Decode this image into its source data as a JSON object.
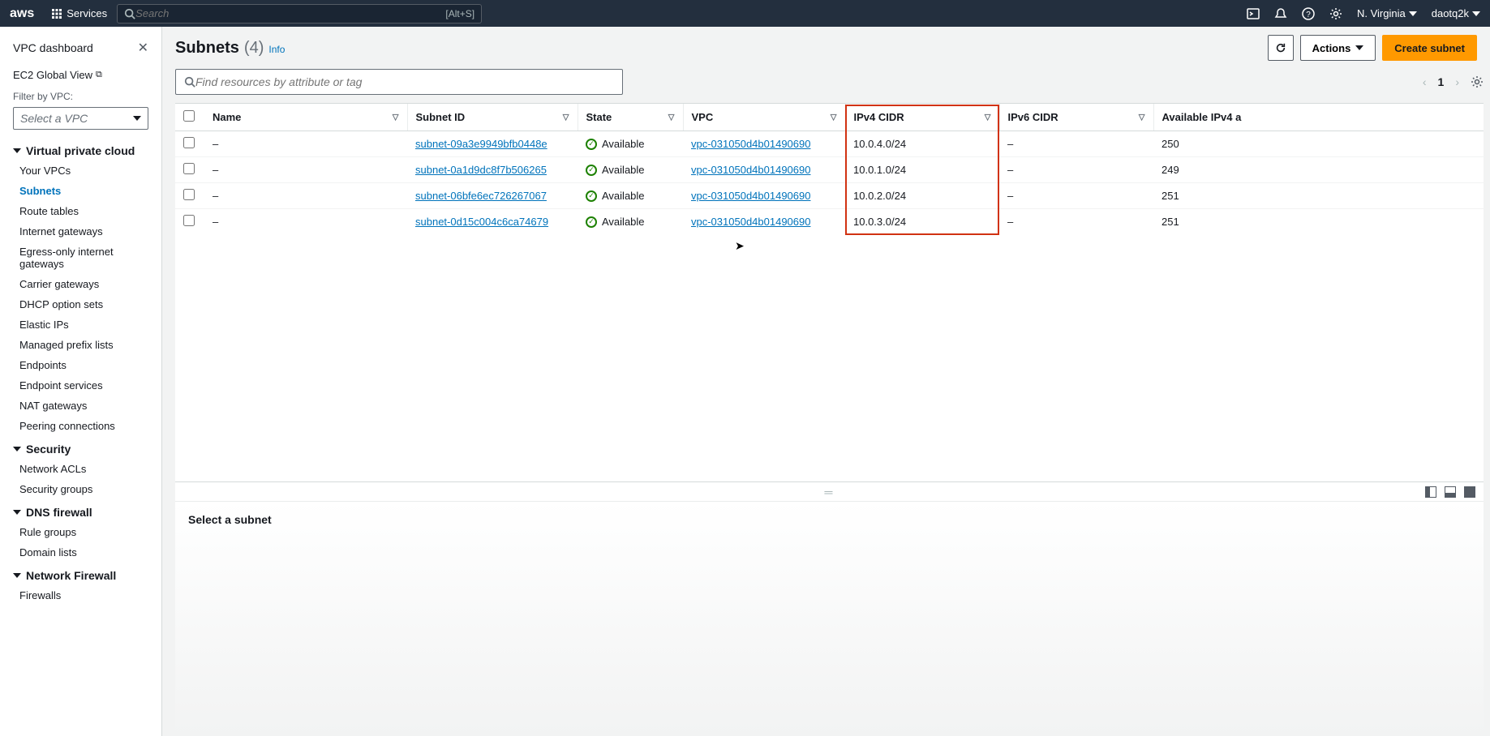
{
  "topnav": {
    "logo": "aws",
    "services": "Services",
    "search_placeholder": "Search",
    "search_shortcut": "[Alt+S]",
    "region": "N. Virginia",
    "user": "daotq2k"
  },
  "sidebar": {
    "dashboard": "VPC dashboard",
    "global_view": "EC2 Global View",
    "filter_label": "Filter by VPC:",
    "filter_placeholder": "Select a VPC",
    "sections": [
      {
        "title": "Virtual private cloud",
        "items": [
          "Your VPCs",
          "Subnets",
          "Route tables",
          "Internet gateways",
          "Egress-only internet gateways",
          "Carrier gateways",
          "DHCP option sets",
          "Elastic IPs",
          "Managed prefix lists",
          "Endpoints",
          "Endpoint services",
          "NAT gateways",
          "Peering connections"
        ],
        "active": "Subnets"
      },
      {
        "title": "Security",
        "items": [
          "Network ACLs",
          "Security groups"
        ]
      },
      {
        "title": "DNS firewall",
        "items": [
          "Rule groups",
          "Domain lists"
        ]
      },
      {
        "title": "Network Firewall",
        "items": [
          "Firewalls"
        ]
      }
    ]
  },
  "page": {
    "title": "Subnets",
    "count": "(4)",
    "info": "Info",
    "actions_label": "Actions",
    "create_label": "Create subnet",
    "filter_placeholder": "Find resources by attribute or tag",
    "page_num": "1",
    "detail_prompt": "Select a subnet"
  },
  "table": {
    "columns": [
      "Name",
      "Subnet ID",
      "State",
      "VPC",
      "IPv4 CIDR",
      "IPv6 CIDR",
      "Available IPv4 a"
    ],
    "rows": [
      {
        "name": "–",
        "subnet_id": "subnet-09a3e9949bfb0448e",
        "state": "Available",
        "vpc": "vpc-031050d4b01490690",
        "ipv4": "10.0.4.0/24",
        "ipv6": "–",
        "avail": "250"
      },
      {
        "name": "–",
        "subnet_id": "subnet-0a1d9dc8f7b506265",
        "state": "Available",
        "vpc": "vpc-031050d4b01490690",
        "ipv4": "10.0.1.0/24",
        "ipv6": "–",
        "avail": "249"
      },
      {
        "name": "–",
        "subnet_id": "subnet-06bfe6ec726267067",
        "state": "Available",
        "vpc": "vpc-031050d4b01490690",
        "ipv4": "10.0.2.0/24",
        "ipv6": "–",
        "avail": "251"
      },
      {
        "name": "–",
        "subnet_id": "subnet-0d15c004c6ca74679",
        "state": "Available",
        "vpc": "vpc-031050d4b01490690",
        "ipv4": "10.0.3.0/24",
        "ipv6": "–",
        "avail": "251"
      }
    ]
  }
}
